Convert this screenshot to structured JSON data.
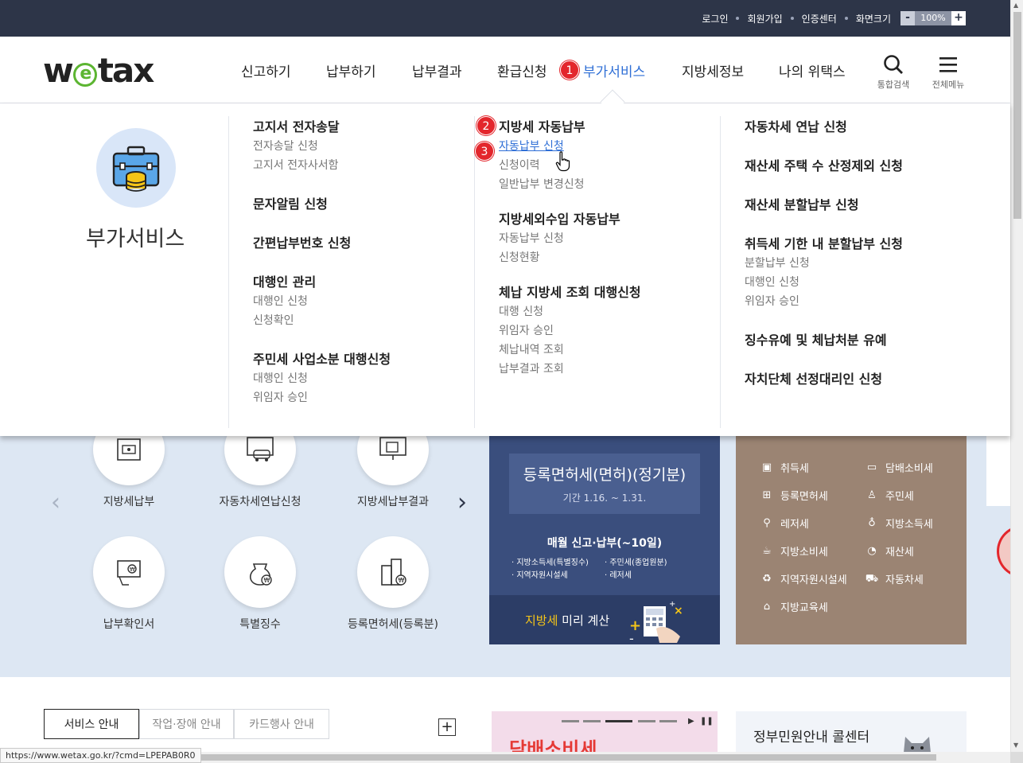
{
  "topbar": {
    "links": [
      "로그인",
      "회원가입",
      "인증센터",
      "화면크기"
    ],
    "zoom_minus": "-",
    "zoom_value": "100%",
    "zoom_plus": "+"
  },
  "header": {
    "logo": {
      "pre": "w",
      "e": "e",
      "post": "tax"
    },
    "nav": [
      "신고하기",
      "납부하기",
      "납부결과",
      "환급신청",
      "부가서비스",
      "지방세정보",
      "나의 위택스"
    ],
    "active_nav": "부가서비스",
    "search_label": "통합검색",
    "menu_label": "전체메뉴",
    "badges": [
      "1",
      "2",
      "3"
    ]
  },
  "mega_menu": {
    "title": "부가서비스",
    "col1": {
      "s1": {
        "heading": "고지서 전자송달",
        "items": [
          "전자송달 신청",
          "고지서 전자사서함"
        ]
      },
      "s2": {
        "heading": "문자알림 신청"
      },
      "s3": {
        "heading": "간편납부번호 신청"
      },
      "s4": {
        "heading": "대행인 관리",
        "items": [
          "대행인 신청",
          "신청확인"
        ]
      },
      "s5": {
        "heading": "주민세 사업소분 대행신청",
        "items": [
          "대행인 신청",
          "위임자 승인"
        ]
      }
    },
    "col2": {
      "s1": {
        "heading": "지방세 자동납부",
        "items": [
          "자동납부 신청",
          "신청이력",
          "일반납부 변경신청"
        ]
      },
      "s2": {
        "heading": "지방세외수입 자동납부",
        "items": [
          "자동납부 신청",
          "신청현황"
        ]
      },
      "s3": {
        "heading": "체납 지방세 조회 대행신청",
        "items": [
          "대행 신청",
          "위임자 승인",
          "체납내역 조회",
          "납부결과 조회"
        ]
      }
    },
    "col3": {
      "s1": {
        "heading": "자동차세 연납 신청"
      },
      "s2": {
        "heading": "재산세 주택 수 산정제외 신청"
      },
      "s3": {
        "heading": "재산세 분할납부 신청"
      },
      "s4": {
        "heading": "취득세 기한 내 분할납부 신청",
        "items": [
          "분할납부 신청",
          "대행인 신청",
          "위임자 승인"
        ]
      },
      "s5": {
        "heading": "징수유예 및 체납처분 유예"
      },
      "s6": {
        "heading": "자치단체 선정대리인 신청"
      }
    }
  },
  "services": [
    "지방세납부",
    "자동차세연납신청",
    "지방세납부결과",
    "납부확인서",
    "특별징수",
    "등록면허세(등록분)"
  ],
  "schedule": {
    "title": "등록면허세(면허)(정기분)",
    "period": "기간 1.16. ~ 1.31.",
    "monthly": "매월 신고·납부(~10일)",
    "left_items": [
      "· 지방소득세(특별징수)",
      "· 지역자원시설세"
    ],
    "right_items": [
      "· 주민세(종업원분)",
      "· 레저세"
    ],
    "calc_highlight": "지방세",
    "calc_rest": " 미리 계산"
  },
  "tax_types": {
    "left": [
      "취득세",
      "등록면허세",
      "레저세",
      "지방소비세",
      "지역자원시설세",
      "지방교육세"
    ],
    "right": [
      "담배소비세",
      "주민세",
      "지방소득세",
      "재산세",
      "자동차세"
    ]
  },
  "tabs": [
    "서비스 안내",
    "작업·장애 안내",
    "카드행사 안내"
  ],
  "tab_more": "+",
  "banner_text": "담배소비세",
  "callcenter": "정부민원안내 콜센터",
  "status_url": "https://www.wetax.go.kr/?cmd=LPEPAB0R0"
}
